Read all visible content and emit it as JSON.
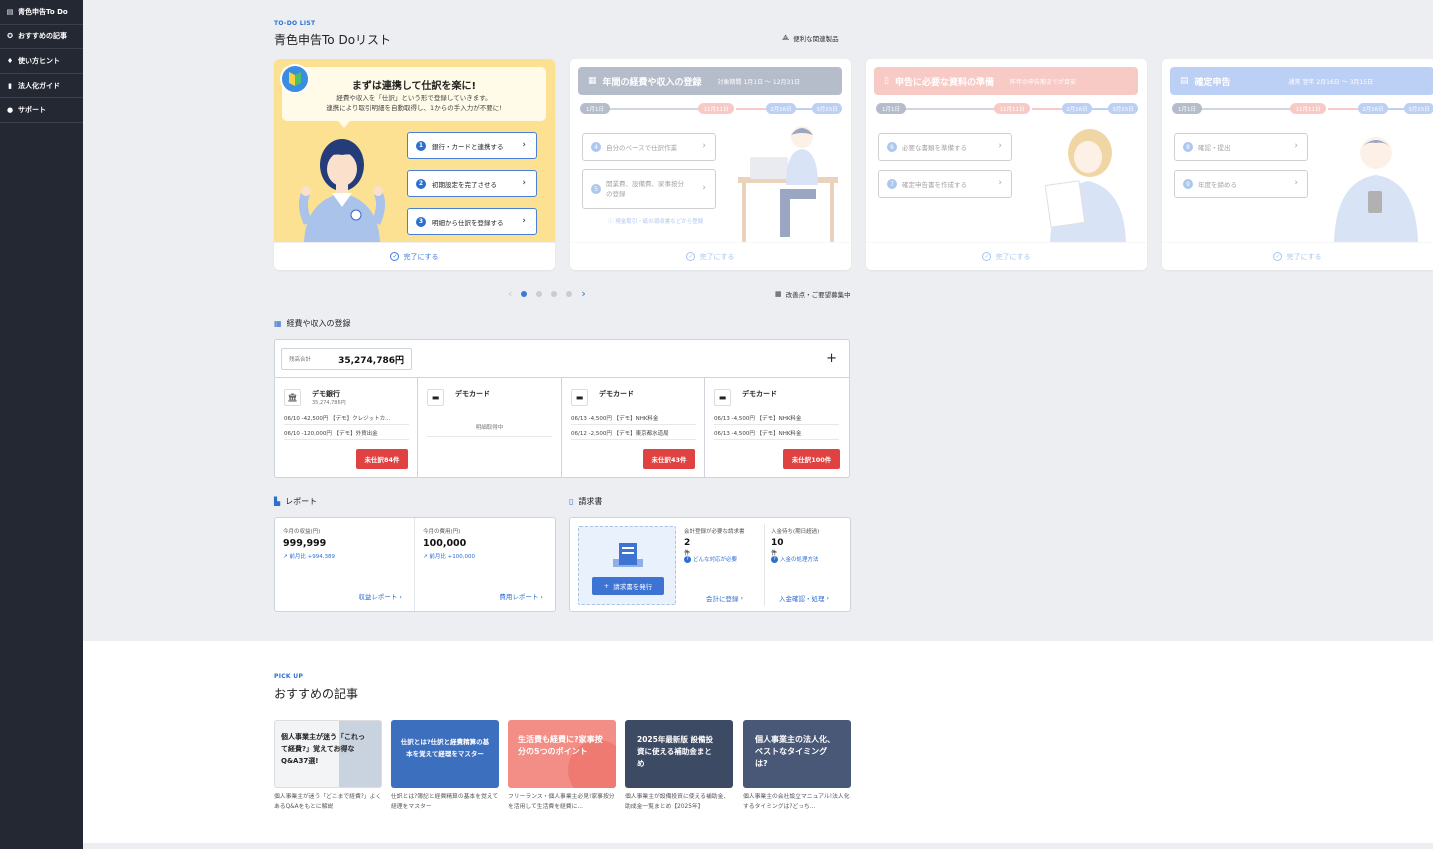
{
  "sidebar": {
    "items": [
      {
        "label": "青色申告To Do",
        "icon": "checklist-icon"
      },
      {
        "label": "おすすめの記事",
        "icon": "star-icon"
      },
      {
        "label": "使い方ヒント",
        "icon": "lightbulb-icon"
      },
      {
        "label": "法人化ガイド",
        "icon": "building-icon"
      },
      {
        "label": "サポート",
        "icon": "info-icon"
      }
    ]
  },
  "todo": {
    "eyebrow": "TO-DO LIST",
    "title": "青色申告To Doリスト",
    "related_link": "便利な関連製品",
    "cards": [
      {
        "title": "まずは連携して仕訳を楽に!",
        "desc1": "経費や収入を「仕訳」という形で登録していきます。",
        "desc2": "連携により取引明細を自動取得し、1からの手入力が不要に!",
        "steps": [
          {
            "num": "1",
            "label": "銀行・カードと連携する"
          },
          {
            "num": "2",
            "label": "初期設定を完了させる"
          },
          {
            "num": "3",
            "label": "明細から仕訳を登録する"
          }
        ],
        "done": "完了にする"
      },
      {
        "title": "年間の経費や収入の登録",
        "subtitle": "対象期間 1月1日 〜 12月31日",
        "timeline": [
          "1月1日",
          "11月11日",
          "2月16日",
          "3月15日"
        ],
        "steps": [
          {
            "num": "4",
            "label": "自分のペースで仕訳作業"
          },
          {
            "num": "5",
            "label": "開業費、設備費、家事按分の登録"
          }
        ],
        "note": "現金取引・紙の領収書などから登録",
        "done": "完了にする"
      },
      {
        "title": "申告に必要な資料の準備",
        "subtitle": "昨年の申告期までが目安",
        "timeline": [
          "1月1日",
          "11月11日",
          "2月16日",
          "3月15日"
        ],
        "steps": [
          {
            "num": "6",
            "label": "必要な書類を準備する"
          },
          {
            "num": "7",
            "label": "確定申告書を作成する"
          }
        ],
        "done": "完了にする"
      },
      {
        "title": "確定申告",
        "subtitle": "通常 翌年 2月16日 〜 3月15日",
        "timeline": [
          "1月1日",
          "11月11日",
          "2月16日",
          "3月15日"
        ],
        "steps": [
          {
            "num": "8",
            "label": "確認・提出"
          },
          {
            "num": "9",
            "label": "年度を締める"
          }
        ],
        "done": "完了にする"
      }
    ],
    "feedback": "改善点・ご要望募集中",
    "carousel_active": 1,
    "carousel_total": 4
  },
  "ledger": {
    "title": "経費や収入の登録",
    "balance_label": "残高合計",
    "balance_value": "35,274,786円",
    "accounts": [
      {
        "name": "デモ銀行",
        "sub": "35,274,786円",
        "icon": "bank-icon",
        "tx": [
          "06/10  -42,500円 【デモ】クレジットカ...",
          "06/10  -120,000円 【デモ】外貨出金"
        ],
        "badge": "未仕訳84件"
      },
      {
        "name": "デモカード",
        "sub": "",
        "icon": "card-icon",
        "fetching": "明細取得中",
        "tx": [],
        "badge": ""
      },
      {
        "name": "デモカード",
        "sub": "",
        "icon": "card-icon",
        "tx": [
          "06/13  -4,500円 【デモ】NHK料金",
          "06/12  -2,500円 【デモ】東京都水道局"
        ],
        "badge": "未仕訳43件"
      },
      {
        "name": "デモカード",
        "sub": "",
        "icon": "card-icon",
        "tx": [
          "06/13  -4,500円 【デモ】NHK料金",
          "06/13  -4,500円 【デモ】NHK料金"
        ],
        "badge": "未仕訳100件"
      }
    ]
  },
  "report": {
    "title": "レポート",
    "income_label": "今月の収益(円)",
    "income_value": "999,999",
    "income_cmp": "前月比 +994,389",
    "income_link": "収益レポート",
    "expense_label": "今月の費用(円)",
    "expense_value": "100,000",
    "expense_cmp": "前月比 +100,000",
    "expense_link": "費用レポート"
  },
  "invoice": {
    "title": "請求書",
    "issue_button": "請求書を発行",
    "need_label": "会計登録が必要な請求書",
    "need_value": "2",
    "need_unit": "件",
    "need_help": "どんな対応が必要",
    "need_link": "会計に登録",
    "wait_label": "入金待ち(期日超過)",
    "wait_value": "10",
    "wait_unit": "件",
    "wait_help": "入金の処理方法",
    "wait_link": "入金確認・処理"
  },
  "pickup": {
    "eyebrow": "PICK UP",
    "title": "おすすめの記事",
    "articles": [
      {
        "img_text": "個人事業主が迷う「これって経費?」覚えてお得なQ&A37選!",
        "caption": "個人事業主が迷う「どこまで経費?」よくあるQ&Aをもとに解説"
      },
      {
        "img_text": "仕訳とは?仕訳と経費精算の基本を覚えて経理をマスター",
        "caption": "仕訳とは?簿記と経費精算の基本を覚えて経理をマスター"
      },
      {
        "img_text": "生活費も経費に?家事按分の5つのポイント",
        "caption": "フリーランス・個人事業主必見!家事按分を活用して生活費を経費に..."
      },
      {
        "img_text": "2025年最新版 設備投資に使える補助金まとめ",
        "caption": "個人事業主が設備投資に使える補助金、助成金一覧まとめ【2025年】"
      },
      {
        "img_text": "個人事業主の法人化、ベストなタイミングは?",
        "caption": "個人事業主の会社設立マニュアル!法人化するタイミングは?どっち..."
      }
    ]
  },
  "colors": {
    "accent": "#2d6fd1",
    "card1_bg": "#fce192",
    "card2_hdr": "#5b6a8a",
    "card3_hdr": "#f08a80",
    "card4_hdr": "#6b95e6",
    "danger": "#e04141",
    "sidebar_bg": "#242832"
  }
}
